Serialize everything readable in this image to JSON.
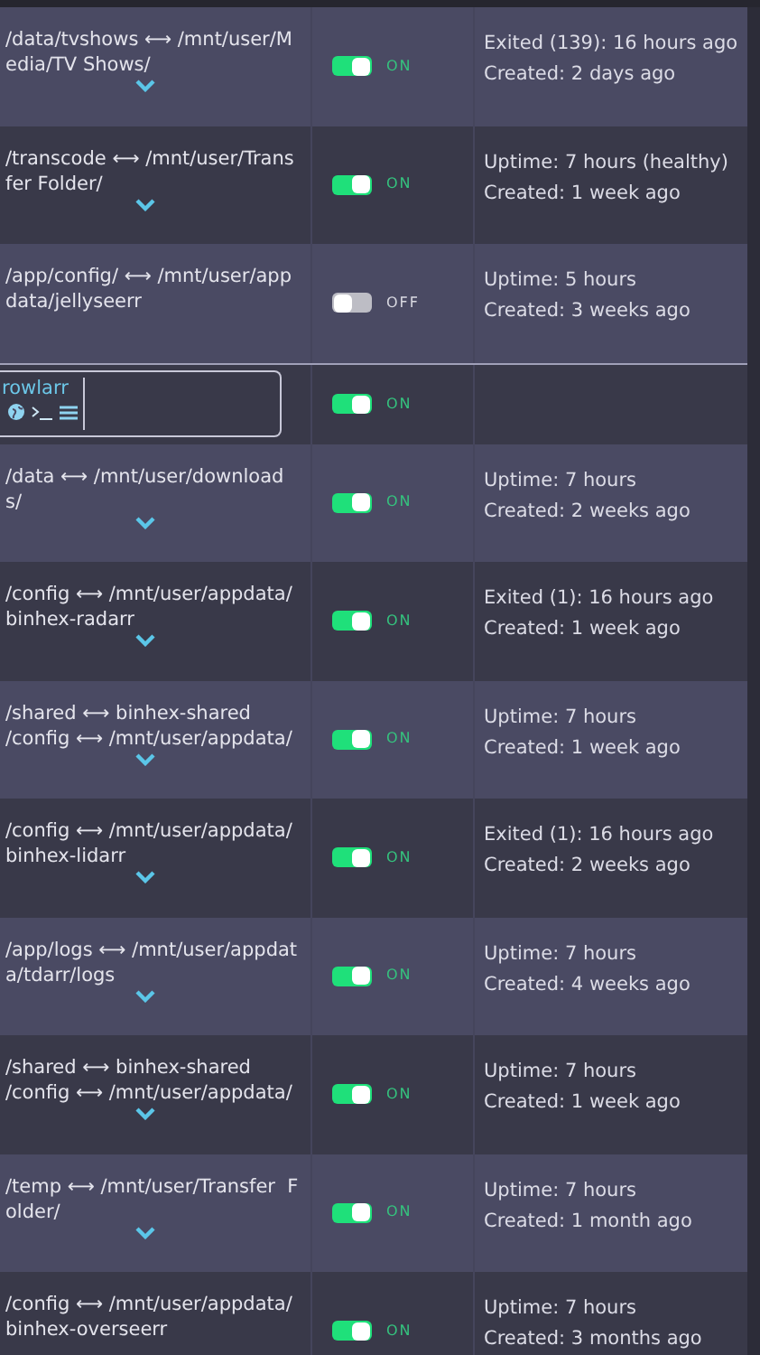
{
  "rows": [
    {
      "kind": "mapping",
      "lines": [
        "/data/tvshows ⟷ /mnt/user/M",
        "edia/TV Shows/"
      ],
      "expandable": true,
      "on": true,
      "toggle_label": "ON",
      "status": [
        "Exited (139): 16 hours ago",
        "Created: 2 days ago"
      ]
    },
    {
      "kind": "mapping",
      "lines": [
        "/transcode ⟷ /mnt/user/Trans",
        "fer Folder/"
      ],
      "expandable": true,
      "on": true,
      "toggle_label": "ON",
      "status": [
        "Uptime: 7 hours (healthy)",
        "Created: 1 week ago"
      ]
    },
    {
      "kind": "mapping",
      "lines": [
        "/app/config/ ⟷ /mnt/user/app",
        "data/jellyseerr"
      ],
      "expandable": false,
      "on": false,
      "toggle_label": "OFF",
      "status": [
        "Uptime: 5 hours",
        "Created: 3 weeks ago"
      ]
    },
    {
      "kind": "app",
      "name": "rowlarr",
      "on": true,
      "toggle_label": "ON"
    },
    {
      "kind": "mapping",
      "lines": [
        "/data ⟷ /mnt/user/download",
        "s/"
      ],
      "expandable": true,
      "on": true,
      "toggle_label": "ON",
      "status": [
        "Uptime: 7 hours",
        "Created: 2 weeks ago"
      ]
    },
    {
      "kind": "mapping",
      "lines": [
        "/config ⟷ /mnt/user/appdata/",
        "binhex-radarr"
      ],
      "expandable": true,
      "on": true,
      "toggle_label": "ON",
      "status": [
        "Exited (1): 16 hours ago",
        "Created: 1 week ago"
      ]
    },
    {
      "kind": "mapping",
      "lines": [
        "/shared ⟷ binhex-shared",
        "/config ⟷ /mnt/user/appdata/"
      ],
      "expandable": true,
      "on": true,
      "toggle_label": "ON",
      "status": [
        "Uptime: 7 hours",
        "Created: 1 week ago"
      ]
    },
    {
      "kind": "mapping",
      "lines": [
        "/config ⟷ /mnt/user/appdata/",
        "binhex-lidarr"
      ],
      "expandable": true,
      "on": true,
      "toggle_label": "ON",
      "status": [
        "Exited (1): 16 hours ago",
        "Created: 2 weeks ago"
      ]
    },
    {
      "kind": "mapping",
      "lines": [
        "/app/logs ⟷ /mnt/user/appdat",
        "a/tdarr/logs"
      ],
      "expandable": true,
      "on": true,
      "toggle_label": "ON",
      "status": [
        "Uptime: 7 hours",
        "Created: 4 weeks ago"
      ]
    },
    {
      "kind": "mapping",
      "lines": [
        "/shared ⟷ binhex-shared",
        "/config ⟷ /mnt/user/appdata/"
      ],
      "expandable": true,
      "on": true,
      "toggle_label": "ON",
      "status": [
        "Uptime: 7 hours",
        "Created: 1 week ago"
      ]
    },
    {
      "kind": "mapping",
      "lines": [
        "/temp ⟷ /mnt/user/Transfer  F",
        "older/"
      ],
      "expandable": true,
      "on": true,
      "toggle_label": "ON",
      "status": [
        "Uptime: 7 hours",
        "Created: 1 month ago"
      ]
    },
    {
      "kind": "mapping",
      "lines": [
        "/config ⟷ /mnt/user/appdata/",
        "binhex-overseerr"
      ],
      "expandable": false,
      "on": true,
      "toggle_label": "ON",
      "status": [
        "Uptime: 7 hours",
        "Created: 3 months ago"
      ]
    }
  ]
}
